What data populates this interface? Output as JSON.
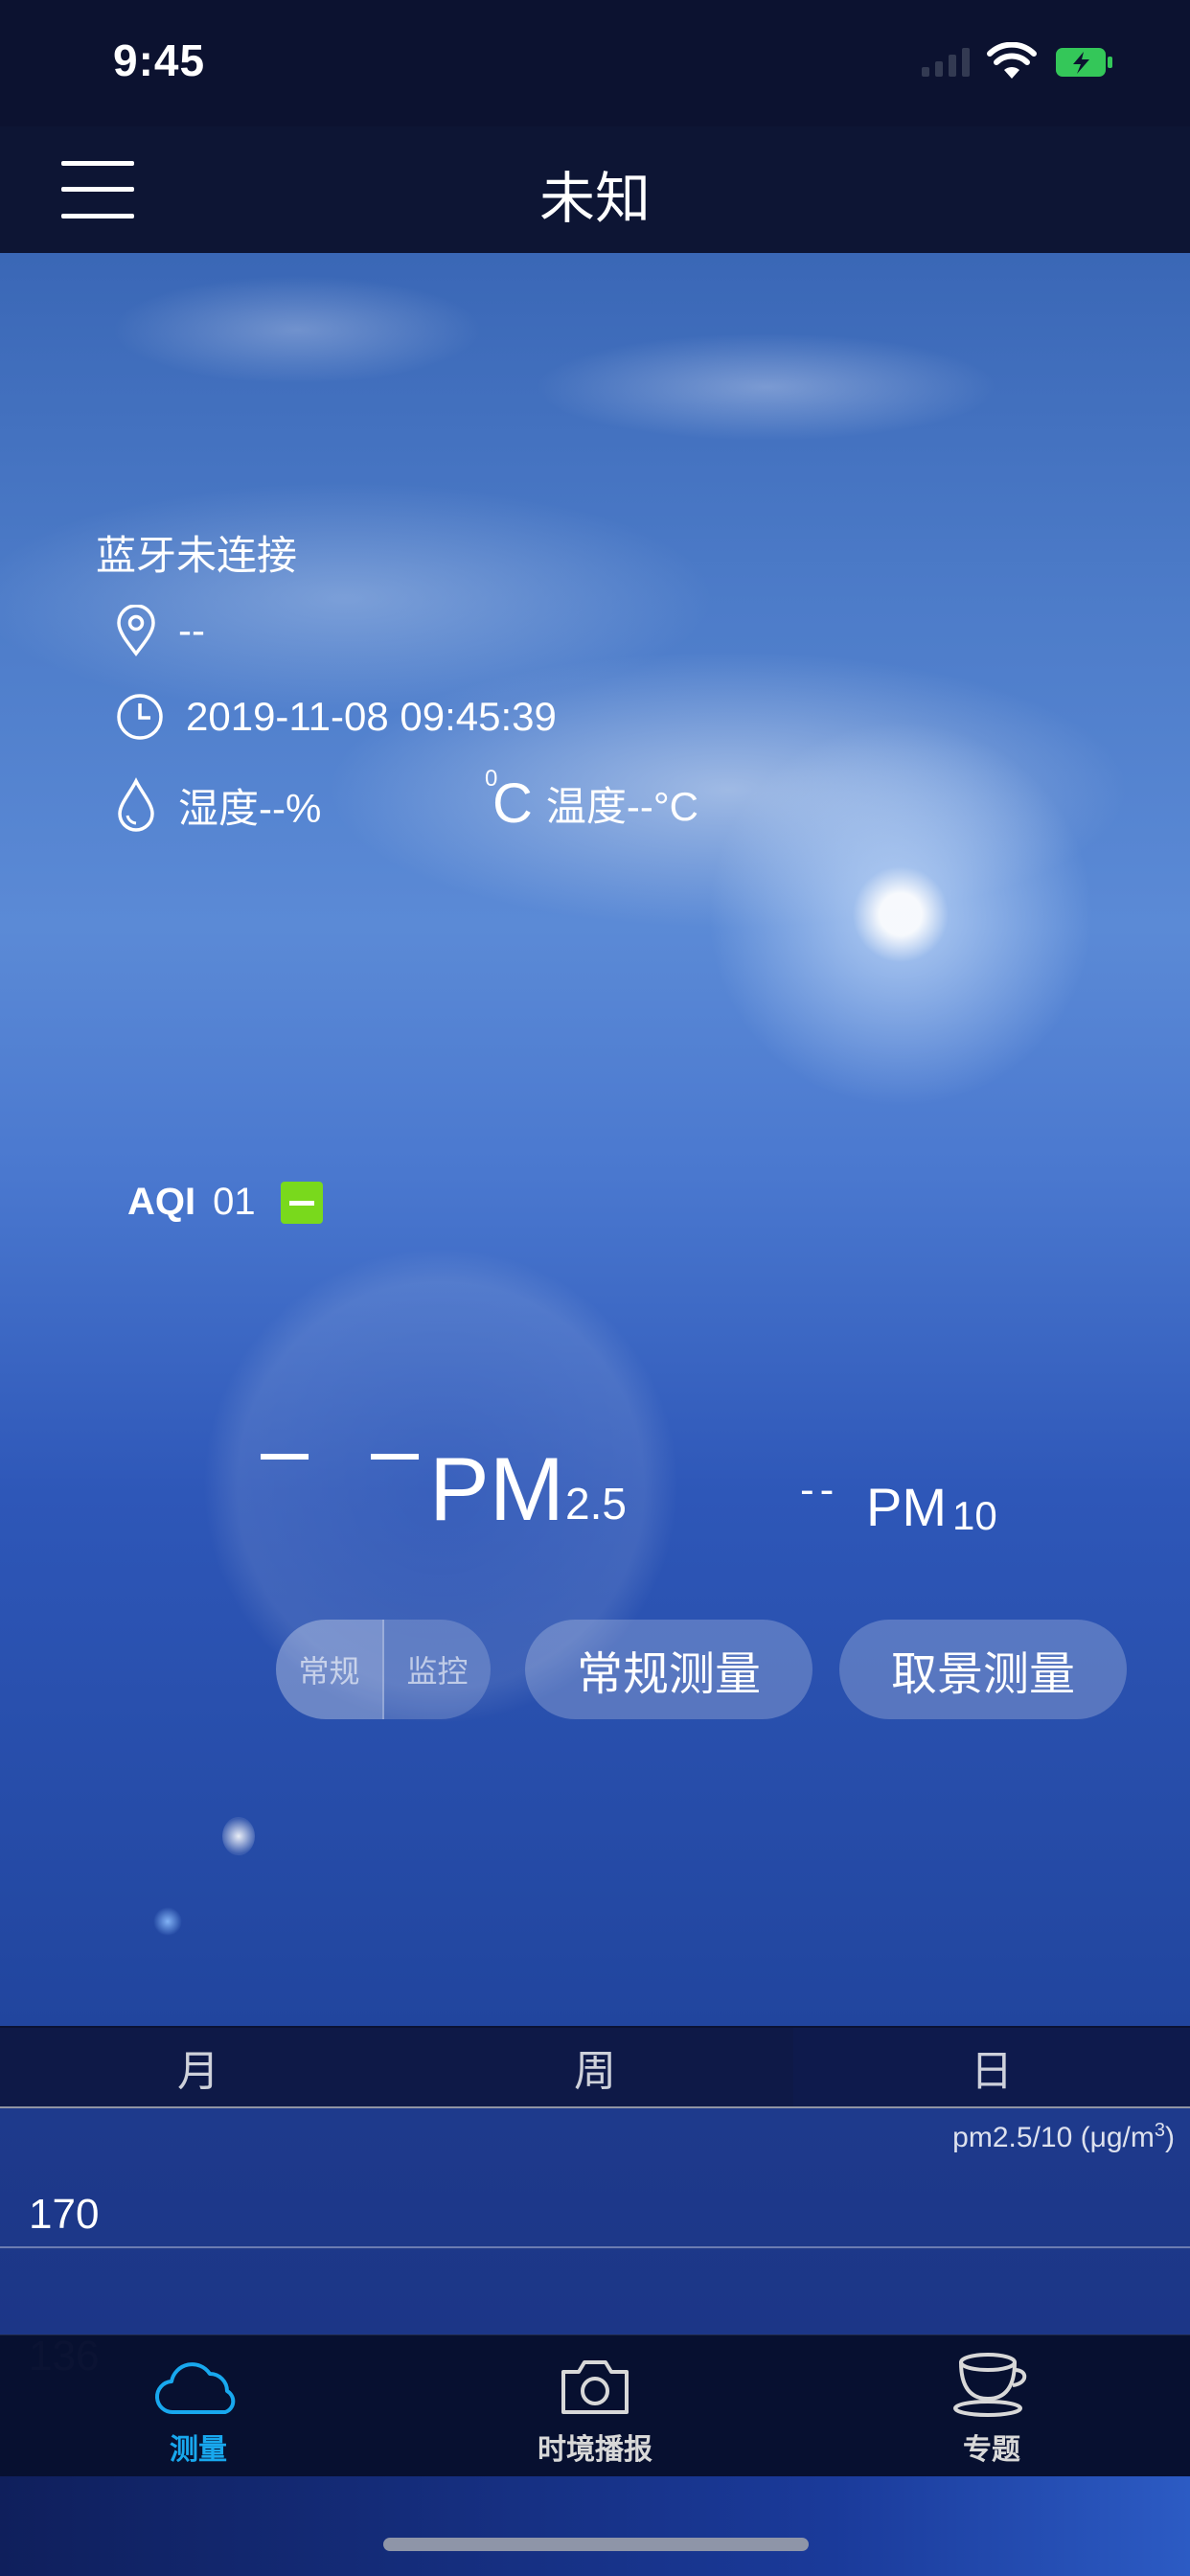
{
  "status_bar": {
    "time": "9:45"
  },
  "nav": {
    "title": "未知"
  },
  "info": {
    "bluetooth_status": "蓝牙未连接",
    "location": "--",
    "datetime": "2019-11-08 09:45:39",
    "humidity": "湿度--%",
    "temperature": "温度--°C",
    "temp_icon": "C",
    "temp_icon_sup": "0"
  },
  "aqi": {
    "label": "AQI",
    "value": "01",
    "level_color": "#79d91c"
  },
  "pm": {
    "pm25_value": "– –",
    "pm25_label": "PM",
    "pm25_sub": "2.5",
    "pm10_value": "--",
    "pm10_label": "PM",
    "pm10_sub": "10"
  },
  "mode_toggle": {
    "normal": "常规",
    "monitor": "监控"
  },
  "buttons": {
    "normal_measure": "常规测量",
    "scene_measure": "取景测量"
  },
  "period_tabs": [
    "月",
    "周",
    "日"
  ],
  "chart": {
    "unit": "pm2.5/10 (μg/m",
    "unit_sup": "3",
    "unit_close": ")",
    "y_labels": [
      "170",
      "136"
    ]
  },
  "tab_bar": {
    "items": [
      {
        "label": "测量",
        "icon": "cloud-icon",
        "active": true,
        "color": "#18a8ee"
      },
      {
        "label": "时境播报",
        "icon": "camera-icon",
        "active": false
      },
      {
        "label": "专题",
        "icon": "cup-icon",
        "active": false
      }
    ]
  }
}
